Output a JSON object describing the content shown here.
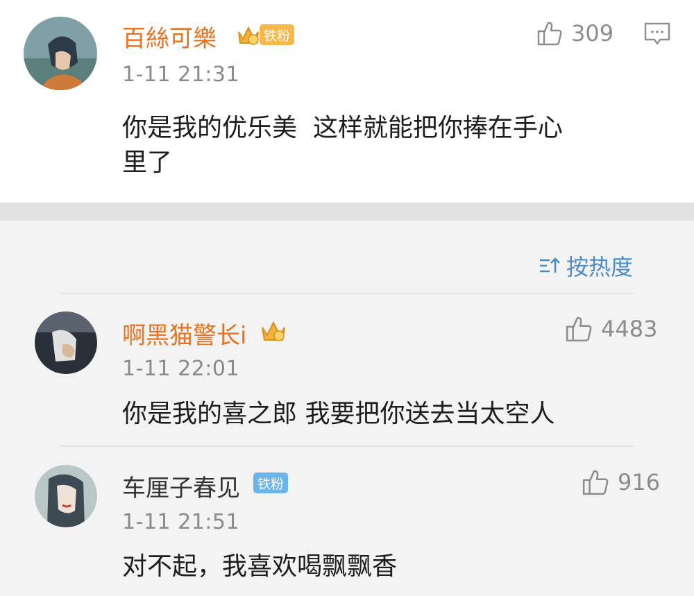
{
  "main_comment": {
    "user": "百絲可樂",
    "fan_badge": "铁粉",
    "time": "1-11 21:31",
    "likes": "309",
    "text_line1": "你是我的优乐美  这样就能把你捧在手心",
    "text_line2": "里了"
  },
  "sort": {
    "label": "按热度"
  },
  "replies": [
    {
      "user": "啊黑猫警长i",
      "time": "1-11 22:01",
      "likes": "4483",
      "text": "你是我的喜之郎 我要把你送去当太空人"
    },
    {
      "user": "车厘子春见",
      "fan_badge": "铁粉",
      "time": "1-11 21:51",
      "likes": "916",
      "text": "对不起，我喜欢喝飘飘香"
    }
  ],
  "colors": {
    "vip_name": "#e8721f",
    "normal_name": "#333333",
    "fan_badge_gold": "#f7b84a",
    "fan_badge_blue": "#6ab6ea",
    "sort_blue": "#4a8bc8",
    "time_gray": "#8a8a8a"
  },
  "icons": [
    "crown-badge-icon",
    "thumbs-up-icon",
    "comment-icon",
    "sort-icon"
  ]
}
